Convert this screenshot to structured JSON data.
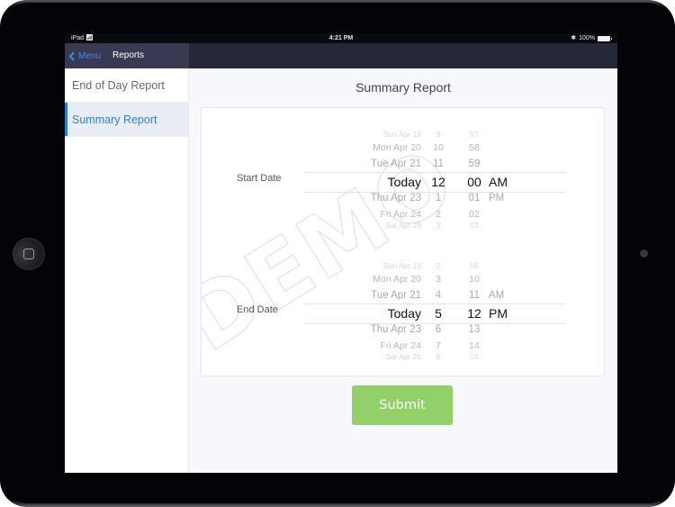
{
  "status_bar": {
    "device": "iPad",
    "wifi_icon": "wifi-icon",
    "time": "4:21 PM",
    "bluetooth_icon": "bluetooth-icon",
    "battery": "100%"
  },
  "nav": {
    "back_label": "Menu",
    "title": "Reports"
  },
  "sidebar": {
    "items": [
      {
        "label": "End of Day Report",
        "active": false
      },
      {
        "label": "Summary Report",
        "active": true
      }
    ]
  },
  "main": {
    "title": "Summary Report",
    "watermark": "DEMO",
    "start": {
      "label": "Start Date",
      "rows": [
        {
          "date": "Sun Apr 19",
          "hour": "9",
          "min": "57",
          "ampm": ""
        },
        {
          "date": "Mon Apr 20",
          "hour": "10",
          "min": "58",
          "ampm": ""
        },
        {
          "date": "Tue Apr 21",
          "hour": "11",
          "min": "59",
          "ampm": ""
        },
        {
          "date": "Today",
          "hour": "12",
          "min": "00",
          "ampm": "AM"
        },
        {
          "date": "Thu Apr 23",
          "hour": "1",
          "min": "01",
          "ampm": "PM"
        },
        {
          "date": "Fri Apr 24",
          "hour": "2",
          "min": "02",
          "ampm": ""
        },
        {
          "date": "Sat Apr 25",
          "hour": "3",
          "min": "03",
          "ampm": ""
        }
      ],
      "selected": {
        "date": "Today",
        "hour": "12",
        "min": "00",
        "ampm": "AM"
      }
    },
    "end": {
      "label": "End Date",
      "rows": [
        {
          "date": "Sun Apr 19",
          "hour": "2",
          "min": "09",
          "ampm": ""
        },
        {
          "date": "Mon Apr 20",
          "hour": "3",
          "min": "10",
          "ampm": ""
        },
        {
          "date": "Tue Apr 21",
          "hour": "4",
          "min": "11",
          "ampm": "AM"
        },
        {
          "date": "Today",
          "hour": "5",
          "min": "12",
          "ampm": "PM"
        },
        {
          "date": "Thu Apr 23",
          "hour": "6",
          "min": "13",
          "ampm": ""
        },
        {
          "date": "Fri Apr 24",
          "hour": "7",
          "min": "14",
          "ampm": ""
        },
        {
          "date": "Sat Apr 25",
          "hour": "8",
          "min": "15",
          "ampm": ""
        }
      ],
      "selected": {
        "date": "Today",
        "hour": "5",
        "min": "12",
        "ampm": "PM"
      }
    },
    "submit_label": "Submit"
  },
  "colors": {
    "accent": "#2e7cd0",
    "nav_bar": "#242837",
    "nav_left": "#373a51",
    "submit": "#94d06a"
  }
}
